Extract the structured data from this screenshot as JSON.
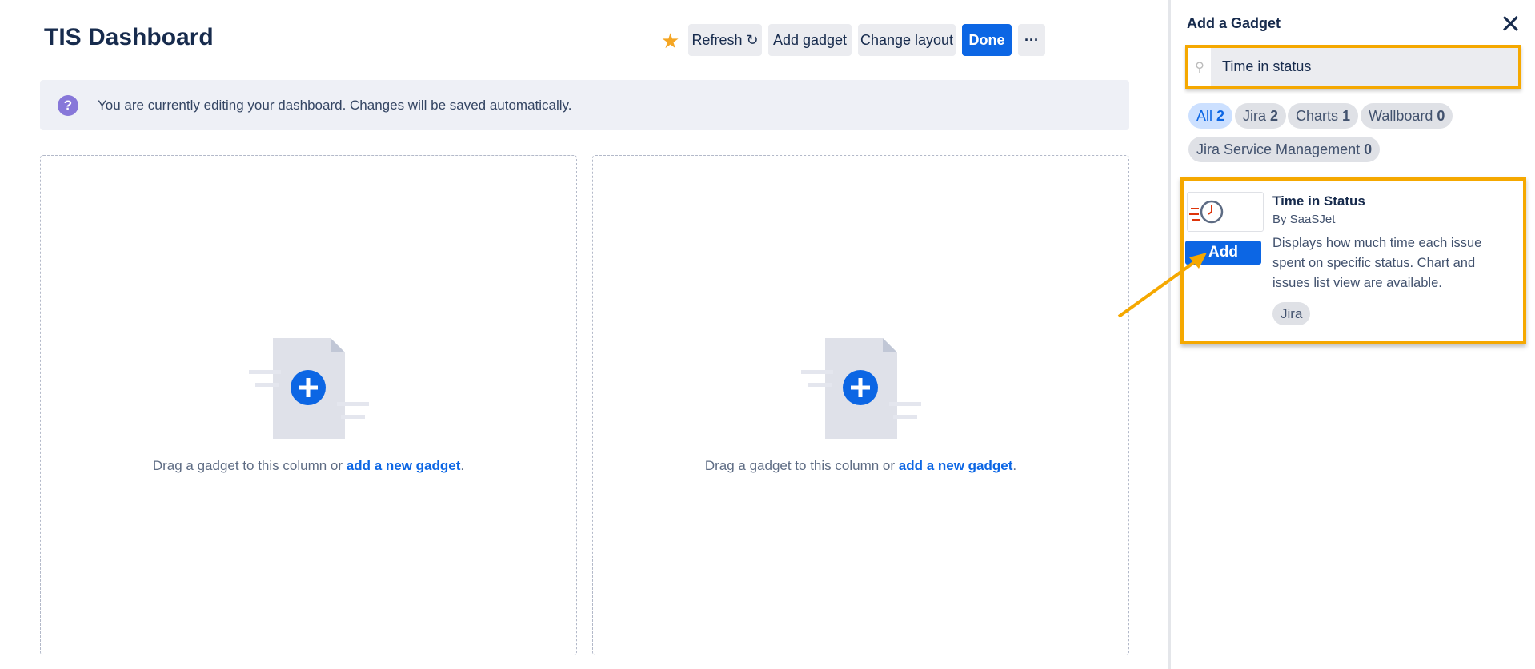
{
  "header": {
    "title": "TIS Dashboard",
    "refresh_label": "Refresh ↻",
    "add_gadget_label": "Add gadget",
    "change_layout_label": "Change layout",
    "done_label": "Done",
    "more_label": "···"
  },
  "banner": {
    "text": "You are currently editing your dashboard. Changes will be saved automatically."
  },
  "columns": [
    {
      "text": "Drag a gadget to this column or ",
      "link": "add a new gadget",
      "end": "."
    },
    {
      "text": "Drag a gadget to this column or ",
      "link": "add a new gadget",
      "end": "."
    }
  ],
  "panel": {
    "title": "Add a Gadget",
    "close": "✕",
    "search_value": "Time in status",
    "filters": [
      {
        "label": "All",
        "count": "2"
      },
      {
        "label": "Jira",
        "count": "2"
      },
      {
        "label": "Charts",
        "count": "1"
      },
      {
        "label": "Wallboard",
        "count": "0"
      },
      {
        "label": "Jira Service Management",
        "count": "0"
      }
    ],
    "gadget": {
      "title": "Time in Status",
      "author": "By SaaSJet",
      "description": "Displays how much time each issue spent on specific status. Chart and issues list view are available.",
      "add_label": "Add",
      "tag": "Jira"
    }
  },
  "colors": {
    "accent": "#0c66e4",
    "highlight": "#f5a800",
    "star": "#f5a623"
  }
}
